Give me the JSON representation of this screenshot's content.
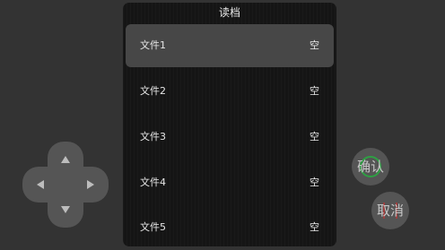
{
  "dialog": {
    "title": "读档",
    "slots": [
      {
        "name": "文件1",
        "state": "空",
        "selected": true
      },
      {
        "name": "文件2",
        "state": "空",
        "selected": false
      },
      {
        "name": "文件3",
        "state": "空",
        "selected": false
      },
      {
        "name": "文件4",
        "state": "空",
        "selected": false
      },
      {
        "name": "文件5",
        "state": "空",
        "selected": false
      }
    ]
  },
  "dpad": {
    "icons": [
      "arrow-up-icon",
      "arrow-down-icon",
      "arrow-left-icon",
      "arrow-right-icon"
    ]
  },
  "buttons": {
    "confirm_label": "确认",
    "cancel_label": "取消"
  },
  "colors": {
    "background": "#333333",
    "panel": "#151515",
    "selected_slot": "#474747",
    "control": "#555555",
    "confirm_accent": "#2ea043",
    "cancel_accent": "#d03030"
  }
}
